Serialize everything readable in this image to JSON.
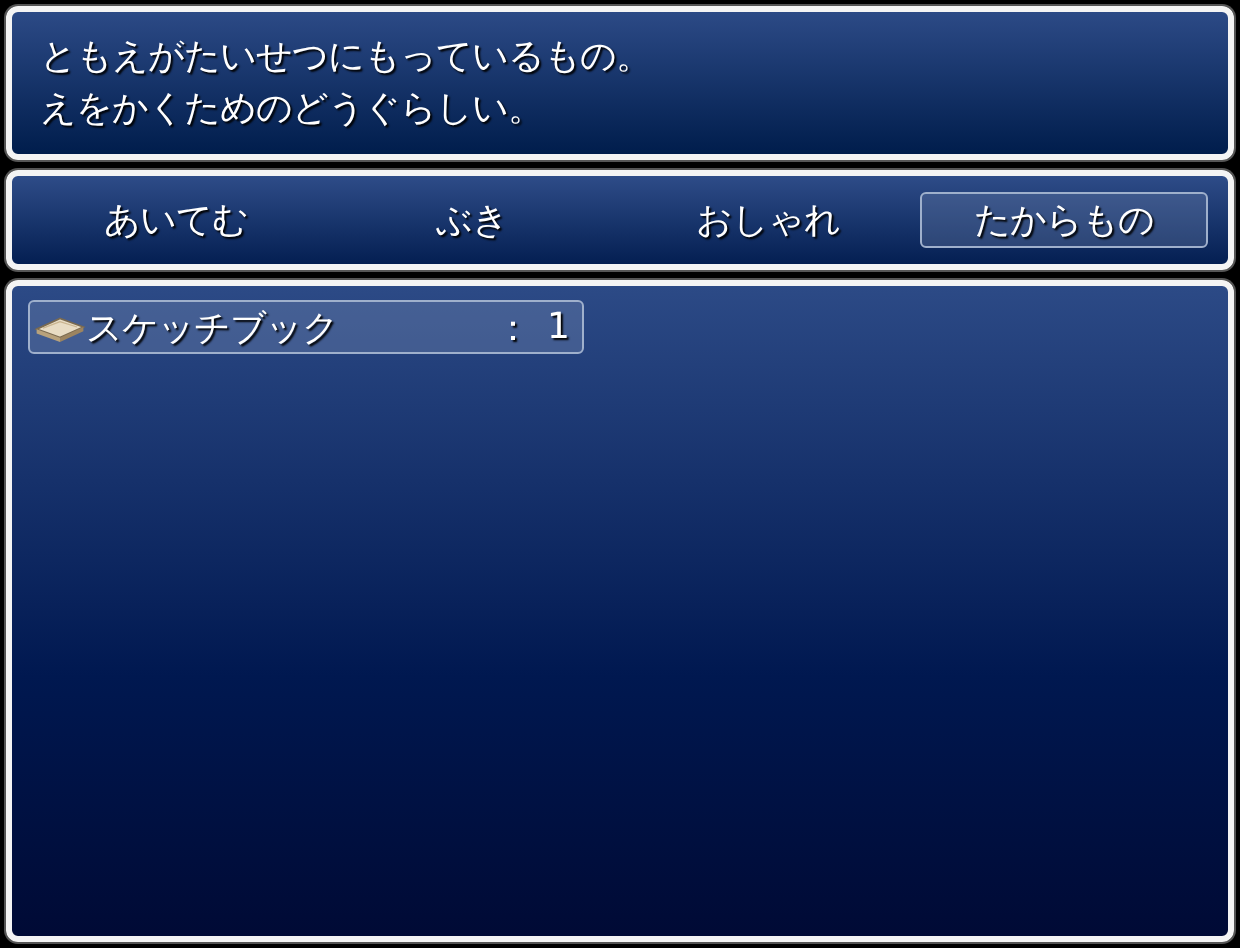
{
  "help": {
    "lines": [
      "ともえがたいせつにもっているもの。",
      "えをかくためのどうぐらしい。"
    ]
  },
  "tabs": [
    {
      "label": "あいてむ",
      "selected": false
    },
    {
      "label": "ぶき",
      "selected": false
    },
    {
      "label": "おしゃれ",
      "selected": false
    },
    {
      "label": "たからもの",
      "selected": true
    }
  ],
  "items": [
    {
      "name": "スケッチブック",
      "separator": "：",
      "count": "1",
      "selected": true
    }
  ]
}
